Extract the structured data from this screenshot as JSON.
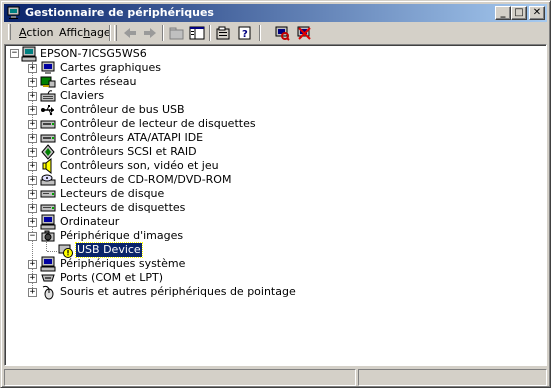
{
  "window": {
    "title": "Gestionnaire de périphériques",
    "controls": {
      "minimize": "_",
      "maximize": "□",
      "close": "✕"
    }
  },
  "menu": {
    "items": [
      {
        "label_accel": "A",
        "label_rest": "ction"
      },
      {
        "label_pre": "Affic",
        "label_accel": "h",
        "label_rest": "age"
      }
    ]
  },
  "toolbar": {
    "buttons": [
      "back-arrow-icon",
      "forward-arrow-icon",
      "folder-up-icon",
      "show-hide-tree-icon",
      "properties-icon",
      "help-icon",
      "scan-hardware-icon",
      "uninstall-icon"
    ]
  },
  "tree": {
    "root": "EPSON-7ICSG5WS6",
    "categories": [
      {
        "label": "Cartes graphiques",
        "icon": "display-adapter-icon"
      },
      {
        "label": "Cartes réseau",
        "icon": "network-card-icon"
      },
      {
        "label": "Claviers",
        "icon": "keyboard-icon"
      },
      {
        "label": "Contrôleur de bus USB",
        "icon": "usb-icon"
      },
      {
        "label": "Contrôleur de lecteur de disquettes",
        "icon": "floppy-controller-icon"
      },
      {
        "label": "Contrôleurs ATA/ATAPI IDE",
        "icon": "ide-controller-icon"
      },
      {
        "label": "Contrôleurs SCSI et RAID",
        "icon": "scsi-controller-icon"
      },
      {
        "label": "Contrôleurs son, vidéo et jeu",
        "icon": "speaker-icon"
      },
      {
        "label": "Lecteurs de CD-ROM/DVD-ROM",
        "icon": "cdrom-icon"
      },
      {
        "label": "Lecteurs de disque",
        "icon": "disk-drive-icon"
      },
      {
        "label": "Lecteurs de disquettes",
        "icon": "floppy-drive-icon"
      },
      {
        "label": "Ordinateur",
        "icon": "computer-icon"
      },
      {
        "label": "Périphérique d'images",
        "icon": "camera-icon",
        "expanded": true,
        "children": [
          {
            "label": "USB Device",
            "icon": "warning-device-icon",
            "selected": true
          }
        ]
      },
      {
        "label": "Périphériques système",
        "icon": "system-device-icon"
      },
      {
        "label": "Ports (COM et LPT)",
        "icon": "port-icon"
      },
      {
        "label": "Souris et autres périphériques de pointage",
        "icon": "mouse-icon"
      }
    ]
  },
  "colors": {
    "title_gradient_start": "#0a246a",
    "title_gradient_end": "#a6caf0",
    "face": "#d4d0c8",
    "selection": "#0a246a"
  }
}
